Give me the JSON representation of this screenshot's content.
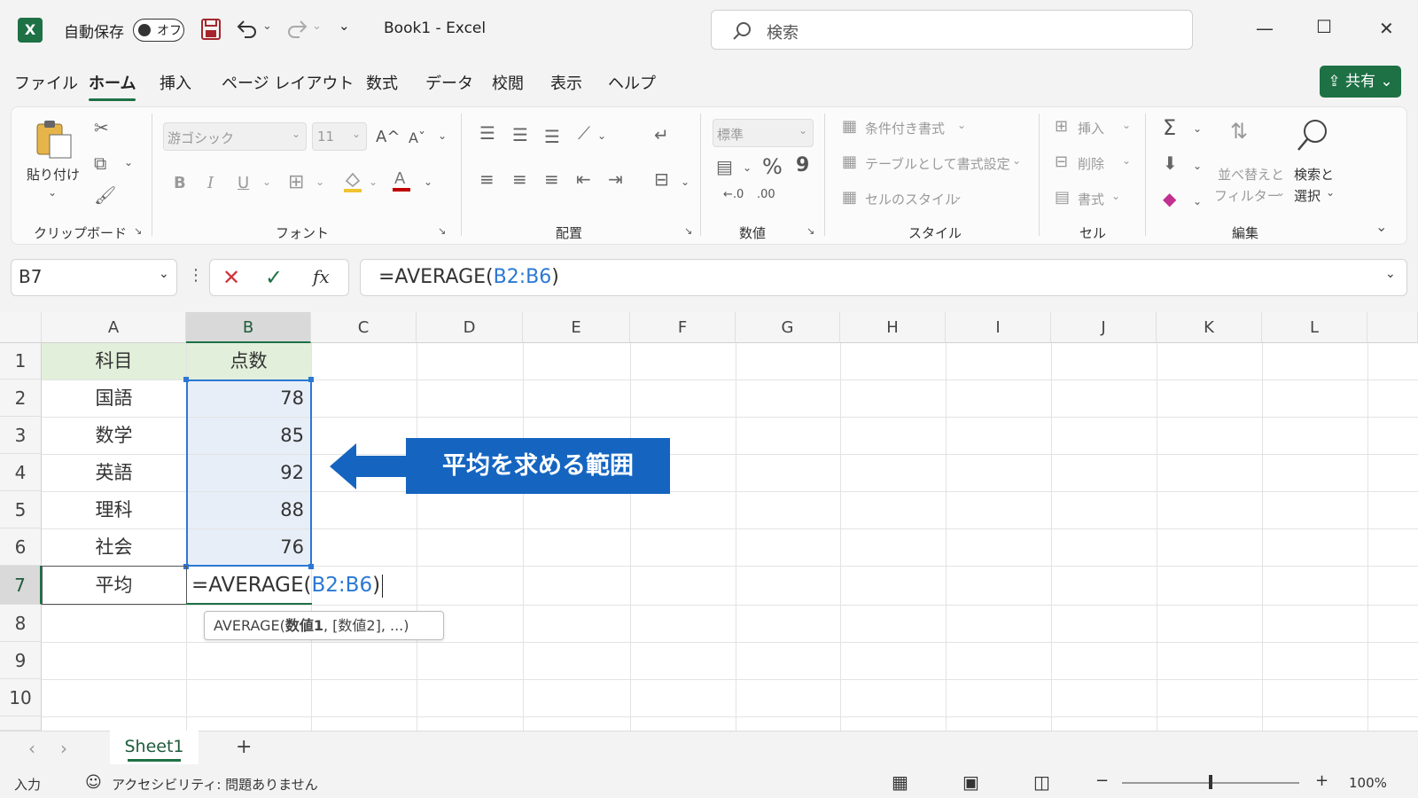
{
  "titlebar": {
    "logo_letter": "X",
    "autosave_label": "自動保存",
    "autosave_state": "オフ",
    "qat_more": "⌄",
    "title": "Book1  -  Excel",
    "search_placeholder": "検索",
    "window_min": "—",
    "window_max": "☐",
    "window_close": "✕"
  },
  "menu": {
    "tabs": [
      "ファイル",
      "ホーム",
      "挿入",
      "ページ レイアウト",
      "数式",
      "データ",
      "校閲",
      "表示",
      "ヘルプ"
    ],
    "active": "ホーム",
    "share_label": "共有"
  },
  "ribbon": {
    "clipboard": {
      "paste_label": "貼り付け",
      "group_label": "クリップボード"
    },
    "font": {
      "font_name": "游ゴシック",
      "font_size": "11",
      "bold": "B",
      "italic": "I",
      "underline": "U",
      "grow": "A^",
      "shrink": "Aˇ",
      "group_label": "フォント"
    },
    "alignment": {
      "group_label": "配置"
    },
    "number": {
      "format": "標準",
      "percent": "%",
      "comma": "9",
      "group_label": "数値"
    },
    "styles": {
      "conditional": "条件付き書式",
      "table": "テーブルとして書式設定",
      "cell_styles": "セルのスタイル",
      "group_label": "スタイル"
    },
    "cells": {
      "insert": "挿入",
      "delete": "削除",
      "format": "書式",
      "group_label": "セル"
    },
    "editing": {
      "sum": "Σ",
      "sort_line1": "並べ替えと",
      "sort_line2": "フィルター",
      "find_line1": "検索と",
      "find_line2": "選択",
      "group_label": "編集"
    }
  },
  "formula_bar": {
    "name_box": "B7",
    "cancel": "✕",
    "enter": "✓",
    "fx": "fx",
    "formula_prefix": "=AVERAGE(",
    "formula_ref": "B2:B6",
    "formula_suffix": ")"
  },
  "grid": {
    "columns": [
      "A",
      "B",
      "C",
      "D",
      "E",
      "F",
      "G",
      "H",
      "I",
      "J",
      "K",
      "L"
    ],
    "rows": [
      "1",
      "2",
      "3",
      "4",
      "5",
      "6",
      "7",
      "8",
      "9",
      "10"
    ],
    "cells": {
      "A1": "科目",
      "B1": "点数",
      "A2": "国語",
      "B2": "78",
      "A3": "数学",
      "B3": "85",
      "A4": "英語",
      "B4": "92",
      "A5": "理科",
      "B5": "88",
      "A6": "社会",
      "B6": "76",
      "A7": "平均"
    },
    "editing_prefix": "=AVERAGE(",
    "editing_ref": "B2:B6",
    "editing_suffix": ")",
    "tooltip_func": "AVERAGE(",
    "tooltip_arg1": "数値1",
    "tooltip_rest": ", [数値2], ...)"
  },
  "callout": {
    "text": "平均を求める範囲"
  },
  "sheets": {
    "nav_prev": "‹",
    "nav_next": "›",
    "tabs": [
      "Sheet1"
    ],
    "add": "+"
  },
  "status": {
    "mode": "入力",
    "accessibility": "アクセシビリティ: 問題ありません",
    "zoom_minus": "−",
    "zoom_plus": "+",
    "zoom": "100%"
  },
  "colors": {
    "accent": "#1e7145",
    "callout": "#1565c0",
    "ref": "#2b78d4",
    "header_fill": "#e2efda",
    "range_fill": "#e8eef8"
  }
}
